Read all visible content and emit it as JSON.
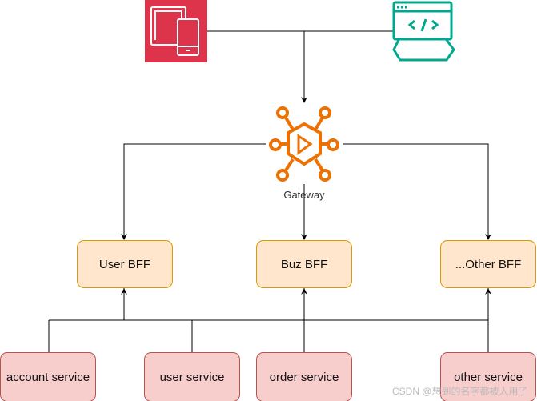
{
  "nodes": {
    "client_mobile": {
      "icon": "mobile-devices-icon",
      "color": "#dd344c"
    },
    "client_web": {
      "icon": "web-browser-code-icon",
      "color": "#01a88d"
    },
    "gateway": {
      "label": "Gateway",
      "icon": "api-gateway-icon",
      "color": "#ed7100"
    },
    "bffs": [
      {
        "label": "User BFF"
      },
      {
        "label": "Buz BFF"
      },
      {
        "label": "...Other BFF"
      }
    ],
    "services": [
      {
        "label": "account service"
      },
      {
        "label": "user service"
      },
      {
        "label": "order service"
      },
      {
        "label": "other service"
      }
    ]
  },
  "colors": {
    "bff_fill": "#ffe6cc",
    "bff_stroke": "#d79b00",
    "service_fill": "#f8cecc",
    "service_stroke": "#b85450"
  },
  "watermark": "CSDN @想到的名字都被人用了"
}
